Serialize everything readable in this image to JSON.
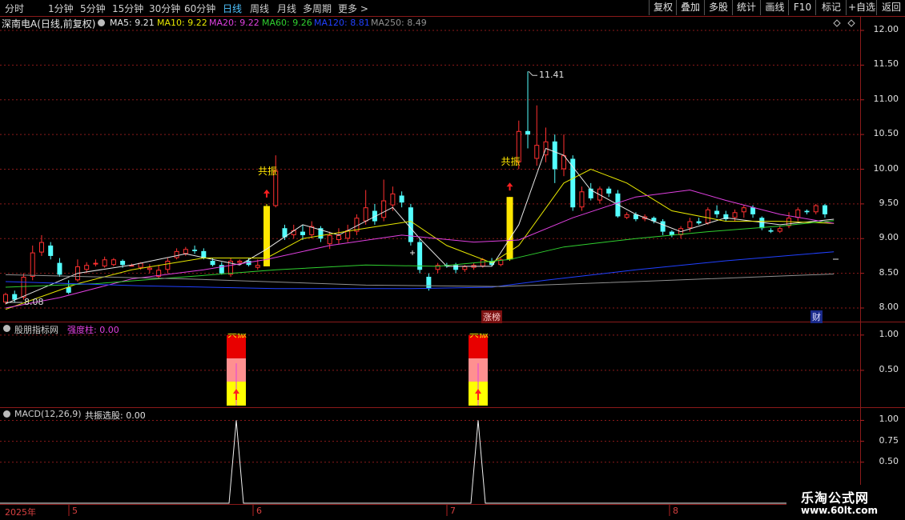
{
  "toolbar": {
    "periods": [
      "分时",
      "1分钟",
      "5分钟",
      "15分钟",
      "30分钟",
      "60分钟",
      "日线",
      "周线",
      "月线",
      "多周期",
      "更多 >"
    ],
    "active_period": "日线",
    "right_buttons": [
      "复权",
      "叠加",
      "多股",
      "统计",
      "画线",
      "F10",
      "标记",
      "+自选",
      "返回"
    ]
  },
  "main_legend": {
    "title": "深南电A(日线,前复权)",
    "ma": [
      {
        "label": "MA5: 9.21",
        "color": "#e8e8e8"
      },
      {
        "label": "MA10: 9.22",
        "color": "#e8e800"
      },
      {
        "label": "MA20: 9.22",
        "color": "#e040e0"
      },
      {
        "label": "MA60: 9.26",
        "color": "#30d030"
      },
      {
        "label": "MA120: 8.81",
        "color": "#2040ff"
      },
      {
        "label": "MA250: 8.49",
        "color": "#909090"
      }
    ]
  },
  "price_axis": [
    "12.00",
    "11.50",
    "11.00",
    "10.50",
    "10.00",
    "9.50",
    "9.00",
    "8.50",
    "8.00"
  ],
  "annotations": {
    "high_label": "11.41",
    "low_label": "8.08",
    "gongzhen": "共振",
    "zhangbang": "涨榜",
    "cai": "财",
    "sub_cut_label": "共振"
  },
  "indicator_panel": {
    "name": "股朋指标网",
    "field": "强度柱: 0.00",
    "axis": [
      "1.00",
      "0.50"
    ]
  },
  "macd_panel": {
    "name": "MACD(12,26,9)",
    "field": "共振选股: 0.00",
    "axis": [
      "1.00",
      "0.75",
      "0.50"
    ]
  },
  "time_axis": [
    "2025年",
    "5",
    "6",
    "7",
    "8"
  ],
  "watermark": {
    "line1": "乐淘公式网",
    "line2": "www.60lt.com"
  },
  "colors": {
    "up": "#ff3030",
    "down": "#54ffff",
    "signal": "#ffe600",
    "grid": "#8b1a1a"
  },
  "chart_data": {
    "type": "candlestick",
    "y_range": [
      7.85,
      12.15
    ],
    "candles": [
      [
        8.08,
        8.2,
        8.05,
        8.22
      ],
      [
        8.2,
        8.12,
        8.08,
        8.25
      ],
      [
        8.15,
        8.45,
        8.12,
        8.5
      ],
      [
        8.45,
        8.8,
        8.4,
        8.9
      ],
      [
        8.8,
        8.95,
        8.75,
        9.05
      ],
      [
        8.9,
        8.75,
        8.7,
        8.95
      ],
      [
        8.65,
        8.48,
        8.45,
        8.72
      ],
      [
        8.3,
        8.22,
        8.2,
        8.4
      ],
      [
        8.4,
        8.6,
        8.38,
        8.7
      ],
      [
        8.55,
        8.62,
        8.5,
        8.66
      ],
      [
        8.65,
        8.65,
        8.6,
        8.7
      ],
      [
        8.6,
        8.7,
        8.58,
        8.74
      ],
      [
        8.62,
        8.7,
        8.6,
        8.72
      ],
      [
        8.68,
        8.62,
        8.58,
        8.7
      ],
      [
        8.62,
        8.62,
        8.6,
        8.64
      ],
      [
        8.58,
        8.65,
        8.55,
        8.66
      ],
      [
        8.55,
        8.58,
        8.5,
        8.63
      ],
      [
        8.45,
        8.55,
        8.42,
        8.62
      ],
      [
        8.55,
        8.68,
        8.5,
        8.72
      ],
      [
        8.72,
        8.82,
        8.7,
        8.86
      ],
      [
        8.78,
        8.85,
        8.75,
        8.88
      ],
      [
        8.84,
        8.82,
        8.78,
        8.9
      ],
      [
        8.82,
        8.72,
        8.7,
        8.86
      ],
      [
        8.68,
        8.62,
        8.6,
        8.72
      ],
      [
        8.62,
        8.5,
        8.48,
        8.66
      ],
      [
        8.48,
        8.68,
        8.45,
        8.72
      ],
      [
        8.65,
        8.68,
        8.62,
        8.7
      ],
      [
        8.68,
        8.62,
        8.6,
        8.72
      ],
      [
        8.58,
        8.62,
        8.55,
        8.7
      ],
      [
        8.6,
        9.47,
        8.6,
        9.5
      ],
      [
        9.47,
        9.98,
        9.45,
        10.2
      ],
      [
        9.15,
        9.02,
        8.98,
        9.2
      ],
      [
        9.05,
        9.12,
        9.0,
        9.2
      ],
      [
        9.1,
        9.05,
        8.98,
        9.2
      ],
      [
        9.05,
        9.18,
        9.0,
        9.25
      ],
      [
        9.15,
        9.0,
        8.95,
        9.18
      ],
      [
        8.92,
        9.05,
        8.85,
        9.1
      ],
      [
        8.98,
        9.05,
        8.92,
        9.15
      ],
      [
        9.0,
        9.12,
        8.95,
        9.2
      ],
      [
        9.1,
        9.3,
        9.05,
        9.35
      ],
      [
        9.25,
        9.45,
        9.2,
        9.7
      ],
      [
        9.4,
        9.25,
        9.2,
        9.5
      ],
      [
        9.3,
        9.55,
        9.25,
        9.85
      ],
      [
        9.48,
        9.65,
        9.4,
        9.75
      ],
      [
        9.62,
        9.52,
        9.45,
        9.68
      ],
      [
        9.45,
        8.95,
        8.9,
        9.5
      ],
      [
        8.95,
        8.55,
        8.5,
        9.0
      ],
      [
        8.45,
        8.28,
        8.25,
        8.5
      ],
      [
        8.55,
        8.62,
        8.5,
        8.65
      ],
      [
        8.62,
        8.6,
        8.58,
        8.65
      ],
      [
        8.62,
        8.55,
        8.5,
        8.65
      ],
      [
        8.55,
        8.6,
        8.52,
        8.62
      ],
      [
        8.58,
        8.62,
        8.55,
        8.65
      ],
      [
        8.6,
        8.7,
        8.58,
        8.72
      ],
      [
        8.68,
        8.62,
        8.6,
        8.72
      ],
      [
        8.62,
        8.7,
        8.6,
        8.72
      ],
      [
        8.7,
        9.6,
        8.68,
        9.6
      ],
      [
        10.1,
        10.55,
        10.0,
        10.7
      ],
      [
        10.55,
        10.5,
        10.3,
        11.41
      ],
      [
        10.15,
        10.35,
        10.05,
        10.92
      ],
      [
        10.2,
        10.4,
        10.1,
        10.6
      ],
      [
        10.4,
        10.0,
        9.8,
        10.5
      ],
      [
        10.0,
        10.2,
        9.9,
        10.5
      ],
      [
        10.15,
        9.45,
        9.4,
        10.2
      ],
      [
        9.45,
        9.68,
        9.4,
        9.75
      ],
      [
        9.72,
        9.58,
        9.55,
        9.8
      ],
      [
        9.55,
        9.72,
        9.5,
        9.75
      ],
      [
        9.72,
        9.65,
        9.6,
        9.75
      ],
      [
        9.65,
        9.32,
        9.3,
        9.7
      ],
      [
        9.3,
        9.35,
        9.28,
        9.38
      ],
      [
        9.35,
        9.28,
        9.25,
        9.38
      ],
      [
        9.28,
        9.32,
        9.25,
        9.35
      ],
      [
        9.3,
        9.25,
        9.22,
        9.32
      ],
      [
        9.25,
        9.1,
        9.05,
        9.28
      ],
      [
        9.1,
        9.05,
        9.02,
        9.12
      ],
      [
        9.05,
        9.15,
        9.0,
        9.18
      ],
      [
        9.15,
        9.25,
        9.1,
        9.3
      ],
      [
        9.25,
        9.22,
        9.2,
        9.3
      ],
      [
        9.22,
        9.42,
        9.2,
        9.45
      ],
      [
        9.4,
        9.35,
        9.3,
        9.48
      ],
      [
        9.35,
        9.28,
        9.25,
        9.4
      ],
      [
        9.3,
        9.38,
        9.25,
        9.42
      ],
      [
        9.38,
        9.45,
        9.3,
        9.48
      ],
      [
        9.45,
        9.35,
        9.3,
        9.48
      ],
      [
        9.3,
        9.15,
        9.12,
        9.32
      ],
      [
        9.12,
        9.1,
        9.08,
        9.15
      ],
      [
        9.1,
        9.15,
        9.08,
        9.18
      ],
      [
        9.18,
        9.3,
        9.15,
        9.38
      ],
      [
        9.3,
        9.42,
        9.25,
        9.45
      ],
      [
        9.4,
        9.38,
        9.35,
        9.42
      ],
      [
        9.38,
        9.48,
        9.35,
        9.5
      ],
      [
        9.48,
        9.35,
        9.3,
        9.5
      ]
    ],
    "signal_bars": [
      29,
      56
    ],
    "ma_series": {
      "MA5": [
        [
          0,
          8.06
        ],
        [
          8,
          8.5
        ],
        [
          14,
          8.62
        ],
        [
          20,
          8.78
        ],
        [
          26,
          8.62
        ],
        [
          29,
          8.85
        ],
        [
          33,
          9.2
        ],
        [
          37,
          9.05
        ],
        [
          43,
          9.45
        ],
        [
          46,
          9.0
        ],
        [
          49,
          8.6
        ],
        [
          54,
          8.6
        ],
        [
          57,
          9.2
        ],
        [
          60,
          10.3
        ],
        [
          62,
          10.2
        ],
        [
          65,
          9.7
        ],
        [
          70,
          9.35
        ],
        [
          75,
          9.1
        ],
        [
          80,
          9.3
        ],
        [
          86,
          9.2
        ],
        [
          92,
          9.28
        ]
      ],
      "MA10": [
        [
          0,
          7.98
        ],
        [
          8,
          8.35
        ],
        [
          14,
          8.55
        ],
        [
          22,
          8.72
        ],
        [
          29,
          8.72
        ],
        [
          33,
          9.0
        ],
        [
          40,
          9.15
        ],
        [
          45,
          9.25
        ],
        [
          49,
          8.9
        ],
        [
          54,
          8.65
        ],
        [
          57,
          8.9
        ],
        [
          62,
          9.8
        ],
        [
          65,
          10.0
        ],
        [
          69,
          9.8
        ],
        [
          74,
          9.4
        ],
        [
          80,
          9.25
        ],
        [
          86,
          9.25
        ],
        [
          92,
          9.22
        ]
      ],
      "MA20": [
        [
          0,
          8.0
        ],
        [
          6,
          8.15
        ],
        [
          14,
          8.42
        ],
        [
          22,
          8.55
        ],
        [
          29,
          8.7
        ],
        [
          36,
          8.9
        ],
        [
          44,
          9.05
        ],
        [
          52,
          8.95
        ],
        [
          57,
          8.98
        ],
        [
          63,
          9.3
        ],
        [
          70,
          9.6
        ],
        [
          76,
          9.7
        ],
        [
          80,
          9.55
        ],
        [
          86,
          9.35
        ],
        [
          92,
          9.22
        ]
      ],
      "MA60": [
        [
          0,
          8.3
        ],
        [
          10,
          8.35
        ],
        [
          20,
          8.45
        ],
        [
          30,
          8.55
        ],
        [
          40,
          8.62
        ],
        [
          48,
          8.6
        ],
        [
          56,
          8.7
        ],
        [
          62,
          8.88
        ],
        [
          70,
          9.0
        ],
        [
          78,
          9.1
        ],
        [
          86,
          9.18
        ],
        [
          92,
          9.26
        ]
      ],
      "MA120": [
        [
          0,
          8.38
        ],
        [
          15,
          8.32
        ],
        [
          30,
          8.28
        ],
        [
          45,
          8.28
        ],
        [
          54,
          8.3
        ],
        [
          60,
          8.4
        ],
        [
          70,
          8.55
        ],
        [
          80,
          8.68
        ],
        [
          92,
          8.81
        ]
      ],
      "MA250": [
        [
          0,
          8.48
        ],
        [
          20,
          8.42
        ],
        [
          40,
          8.33
        ],
        [
          55,
          8.31
        ],
        [
          70,
          8.38
        ],
        [
          92,
          8.49
        ]
      ]
    }
  }
}
